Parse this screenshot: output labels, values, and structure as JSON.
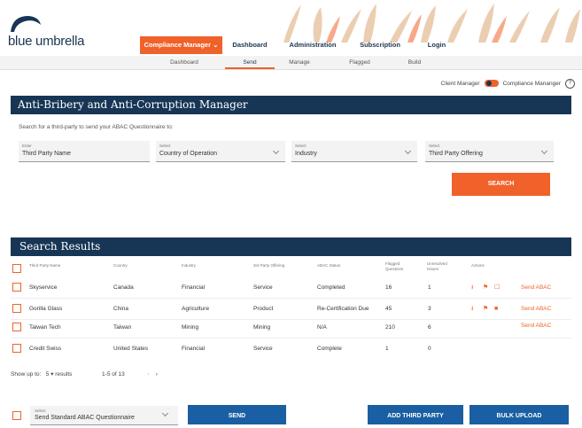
{
  "brand": {
    "name": "blue umbrella"
  },
  "topnav": {
    "compliance_manager": "Compliance Manager",
    "dashboard": "Dashboard",
    "administration": "Administration",
    "subscription": "Subscription",
    "login": "Login"
  },
  "subnav": {
    "dashboard": "Dashboard",
    "send": "Send",
    "manage": "Manage",
    "flagged": "Flagged",
    "build": "Build"
  },
  "toggle": {
    "left_label": "Client Manager",
    "right_label": "Compliance Mananger",
    "help": "?"
  },
  "manager_title": "Anti-Bribery and Anti-Corruption Manager",
  "search_hint": "Search for a third-party to send your ABAC Questionnaire to:",
  "filters": [
    {
      "label": "Enter",
      "value": "Third Party Name"
    },
    {
      "label": "Select",
      "value": "Country of Operation"
    },
    {
      "label": "Select",
      "value": "Industry"
    },
    {
      "label": "Select",
      "value": "Third Party Offering"
    }
  ],
  "search_button": "SEARCH",
  "results_title": "Search Results",
  "columns": {
    "name": "Third Party Name",
    "country": "Country",
    "industry": "Industry",
    "offering": "3rd Party Offering",
    "status": "ABAC Status",
    "flagged": "Flagged Questions",
    "unresolved": "Unresolved Issues",
    "actions": "Actions"
  },
  "rows": [
    {
      "name": "Skyservice",
      "country": "Canada",
      "industry": "Financial",
      "offering": "Service",
      "status": "Completed",
      "flagged": "16",
      "unresolved": "1",
      "send": "Send ABAC"
    },
    {
      "name": "Gorilla Glass",
      "country": "China",
      "industry": "Agriculture",
      "offering": "Product",
      "status": "Re-Certification Due",
      "flagged": "45",
      "unresolved": "3",
      "send": "Send ABAC"
    },
    {
      "name": "Taiwan Tech",
      "country": "Taiwan",
      "industry": "Mining",
      "offering": "Mining",
      "status": "N/A",
      "flagged": "210",
      "unresolved": "6",
      "send": "Send ABAC"
    },
    {
      "name": "Credit Swiss",
      "country": "United States",
      "industry": "Financial",
      "offering": "Service",
      "status": "Complete",
      "flagged": "1",
      "unresolved": "0",
      "send": ""
    }
  ],
  "paging": {
    "show_up_to": "Show up to:",
    "count": "5",
    "results": "results",
    "range": "1-5 of 13"
  },
  "bulk": {
    "select_label": "Select",
    "select_value": "Send Standard ABAC Questionnaire",
    "send": "SEND",
    "add_third_party": "ADD THIRD PARTY",
    "bulk_upload": "BULK UPLOAD"
  },
  "colors": {
    "navy": "#173656",
    "orange": "#f0622a",
    "blue_button": "#1a5fa3"
  }
}
